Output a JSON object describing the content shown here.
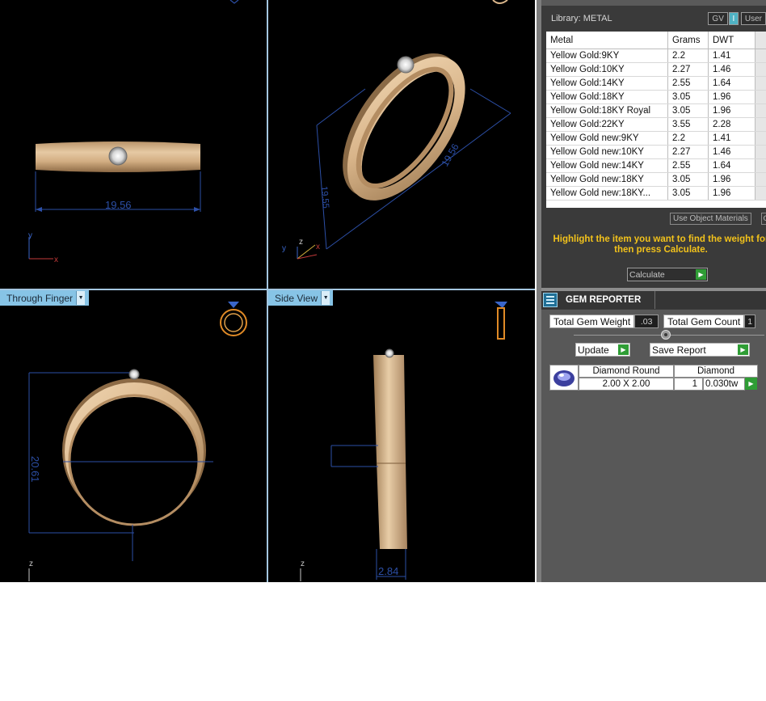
{
  "viewports": {
    "top_left": {
      "dimension": "19.56",
      "axes": [
        "y",
        "x"
      ]
    },
    "top_right": {
      "dimension_a": "19.56",
      "dimension_b": "19.55",
      "axes": [
        "y",
        "z",
        "x"
      ]
    },
    "bottom_left": {
      "tab_label": "Through Finger",
      "dimension": "20.61",
      "axis": "z"
    },
    "bottom_right": {
      "tab_label": "Side View",
      "dimension": "2.84",
      "axis": "z"
    }
  },
  "library": {
    "title": "Library: METAL",
    "buttons": {
      "gv": "GV",
      "user": "User"
    },
    "columns": [
      "Metal",
      "Grams",
      "DWT"
    ],
    "rows": [
      {
        "metal": "Yellow Gold:9KY",
        "grams": "2.2",
        "dwt": "1.41"
      },
      {
        "metal": "Yellow Gold:10KY",
        "grams": "2.27",
        "dwt": "1.46"
      },
      {
        "metal": "Yellow Gold:14KY",
        "grams": "2.55",
        "dwt": "1.64"
      },
      {
        "metal": "Yellow Gold:18KY",
        "grams": "3.05",
        "dwt": "1.96"
      },
      {
        "metal": "Yellow Gold:18KY Royal",
        "grams": "3.05",
        "dwt": "1.96"
      },
      {
        "metal": "Yellow Gold:22KY",
        "grams": "3.55",
        "dwt": "2.28"
      },
      {
        "metal": "Yellow Gold new:9KY",
        "grams": "2.2",
        "dwt": "1.41"
      },
      {
        "metal": "Yellow Gold new:10KY",
        "grams": "2.27",
        "dwt": "1.46"
      },
      {
        "metal": "Yellow Gold new:14KY",
        "grams": "2.55",
        "dwt": "1.64"
      },
      {
        "metal": "Yellow Gold new:18KY",
        "grams": "3.05",
        "dwt": "1.96"
      },
      {
        "metal": "Yellow Gold new:18KY...",
        "grams": "3.05",
        "dwt": "1.96"
      }
    ],
    "use_object_materials": "Use Object Materials",
    "highlight_message": "Highlight the item you want to find the weight for then press Calculate.",
    "calculate_label": "Calculate"
  },
  "gem_reporter": {
    "title": "GEM REPORTER",
    "total_weight_label": "Total Gem Weight",
    "total_weight_value": ".03",
    "total_count_label": "Total Gem Count",
    "total_count_value": "1",
    "update_label": "Update",
    "save_report_label": "Save Report",
    "gems": [
      {
        "shape": "Diamond Round",
        "material": "Diamond",
        "size": "2.00 X 2.00",
        "count": "1",
        "weight": "0.030tw"
      }
    ]
  },
  "colors": {
    "viewport_bg": "#000000",
    "ring_gold": "#d9b58a",
    "dimension_blue": "#2c4fa6",
    "tab_blue": "#87c4e6",
    "highlight_yellow": "#f2c21b",
    "play_green": "#2f9d35"
  },
  "icons": [
    "ring-view-icon",
    "side-view-icon",
    "gem-reporter-icon",
    "play-icon",
    "diamond-thumbnail-icon",
    "dropdown-arrow-icon"
  ]
}
